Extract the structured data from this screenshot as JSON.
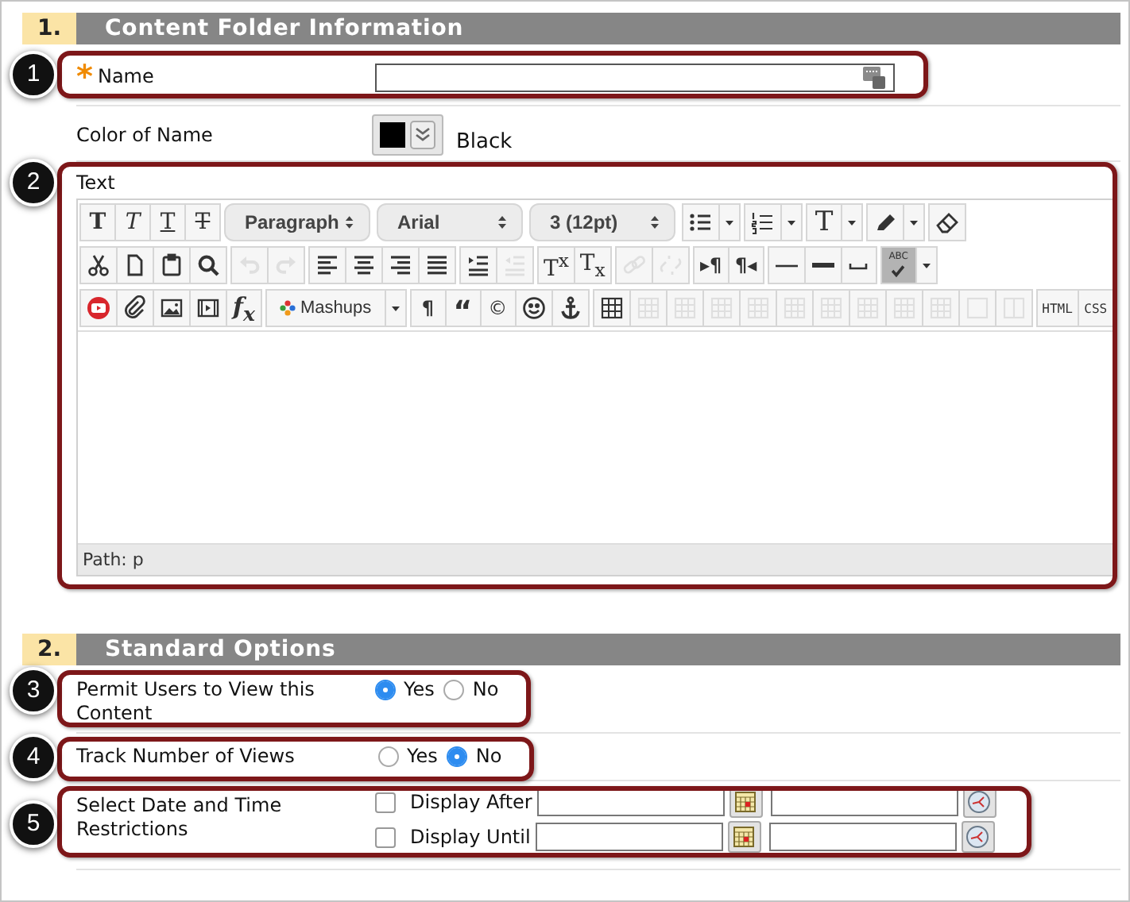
{
  "section1": {
    "number": "1.",
    "title": "Content Folder Information"
  },
  "name_field": {
    "callout": "1",
    "required_mark": "*",
    "label": "Name"
  },
  "color_of_name": {
    "label": "Color of Name",
    "color": "#000000",
    "value": "Black"
  },
  "text_editor": {
    "callout": "2",
    "label": "Text",
    "path": "Path: p",
    "toolbar": [
      [
        [
          {
            "kind": "bold",
            "label": "T",
            "disabled": false
          },
          {
            "kind": "italic",
            "label": "T",
            "disabled": false
          },
          {
            "kind": "underline",
            "label": "T",
            "disabled": false
          },
          {
            "kind": "strike",
            "label": "T",
            "disabled": false
          }
        ],
        [
          {
            "kind": "select",
            "label": "Paragraph",
            "disabled": false
          }
        ],
        [
          {
            "kind": "select",
            "label": "Arial",
            "disabled": false
          }
        ],
        [
          {
            "kind": "select",
            "label": "3 (12pt)",
            "disabled": false
          }
        ],
        [
          {
            "kind": "bullets",
            "disabled": false
          },
          {
            "kind": "caret",
            "disabled": false
          }
        ],
        [
          {
            "kind": "numbers",
            "disabled": false
          },
          {
            "kind": "caret",
            "disabled": false
          }
        ],
        [
          {
            "kind": "text-color",
            "label": "T",
            "disabled": false
          },
          {
            "kind": "caret",
            "disabled": false
          }
        ],
        [
          {
            "kind": "highlighter",
            "disabled": false
          },
          {
            "kind": "caret",
            "disabled": false
          }
        ],
        [
          {
            "kind": "eraser",
            "disabled": false
          }
        ]
      ],
      [
        [
          {
            "kind": "cut",
            "disabled": false
          },
          {
            "kind": "copy",
            "disabled": false
          },
          {
            "kind": "paste",
            "disabled": false
          },
          {
            "kind": "find",
            "disabled": false
          }
        ],
        [
          {
            "kind": "undo",
            "disabled": true
          },
          {
            "kind": "redo",
            "disabled": true
          }
        ],
        [
          {
            "kind": "align-left",
            "disabled": false
          },
          {
            "kind": "align-center",
            "disabled": false
          },
          {
            "kind": "align-right",
            "disabled": false
          },
          {
            "kind": "justify",
            "disabled": false
          }
        ],
        [
          {
            "kind": "indent",
            "disabled": false
          },
          {
            "kind": "outdent",
            "disabled": true
          }
        ],
        [
          {
            "kind": "superscript",
            "label": "T$^{x}$",
            "disabled": false
          },
          {
            "kind": "subscript",
            "label": "T$_{x}$",
            "disabled": false
          }
        ],
        [
          {
            "kind": "link",
            "disabled": true
          },
          {
            "kind": "unlink",
            "disabled": true
          }
        ],
        [
          {
            "kind": "ltr",
            "label": "▸¶",
            "disabled": false
          },
          {
            "kind": "rtl",
            "label": "¶◂",
            "disabled": false
          }
        ],
        [
          {
            "kind": "hr",
            "disabled": false
          },
          {
            "kind": "thick-hr",
            "disabled": false
          },
          {
            "kind": "nbsp",
            "disabled": false
          }
        ],
        [
          {
            "kind": "spellcheck",
            "label": "ABC",
            "disabled": false
          },
          {
            "kind": "caret",
            "disabled": false
          }
        ]
      ],
      [
        [
          {
            "kind": "youtube",
            "disabled": false
          },
          {
            "kind": "attach",
            "disabled": false
          },
          {
            "kind": "image",
            "disabled": false
          },
          {
            "kind": "media",
            "disabled": false
          },
          {
            "kind": "formula",
            "label": "f$_{x}$",
            "disabled": false
          }
        ],
        [
          {
            "kind": "mashups",
            "label": "Mashups",
            "disabled": false
          },
          {
            "kind": "caret",
            "disabled": false
          }
        ],
        [
          {
            "kind": "pilcrow",
            "label": "¶",
            "disabled": false
          },
          {
            "kind": "quote",
            "label": "“",
            "disabled": false
          },
          {
            "kind": "copyright",
            "label": "©",
            "disabled": false
          },
          {
            "kind": "smiley",
            "disabled": false
          },
          {
            "kind": "anchor",
            "disabled": false
          }
        ],
        [
          {
            "kind": "table",
            "disabled": false
          },
          {
            "kind": "table-op",
            "disabled": true
          },
          {
            "kind": "table-op",
            "disabled": true
          },
          {
            "kind": "table-op",
            "disabled": true
          },
          {
            "kind": "table-op",
            "disabled": true
          },
          {
            "kind": "table-op",
            "disabled": true
          },
          {
            "kind": "table-op",
            "disabled": true
          },
          {
            "kind": "table-op",
            "disabled": true
          },
          {
            "kind": "table-op",
            "disabled": true
          },
          {
            "kind": "table-op",
            "disabled": true
          },
          {
            "kind": "box",
            "disabled": true
          },
          {
            "kind": "columns",
            "disabled": true
          }
        ],
        [
          {
            "kind": "code",
            "label": "HTML",
            "disabled": false
          },
          {
            "kind": "code",
            "label": "CSS",
            "disabled": false
          }
        ]
      ]
    ]
  },
  "section2": {
    "number": "2.",
    "title": "Standard Options"
  },
  "options": [
    {
      "kind": "radio",
      "callout": "3",
      "label": "Permit Users to View this Content",
      "choices": [
        {
          "label": "Yes",
          "selected": true
        },
        {
          "label": "No",
          "selected": false
        }
      ]
    },
    {
      "kind": "radio",
      "callout": "4",
      "label": "Track Number of Views",
      "choices": [
        {
          "label": "Yes",
          "selected": false
        },
        {
          "label": "No",
          "selected": true
        }
      ]
    },
    {
      "kind": "dates",
      "callout": "5",
      "label": "Select Date and Time Restrictions",
      "dates": [
        {
          "label": "Display After",
          "checked": false
        },
        {
          "label": "Display Until",
          "checked": false
        }
      ]
    }
  ]
}
